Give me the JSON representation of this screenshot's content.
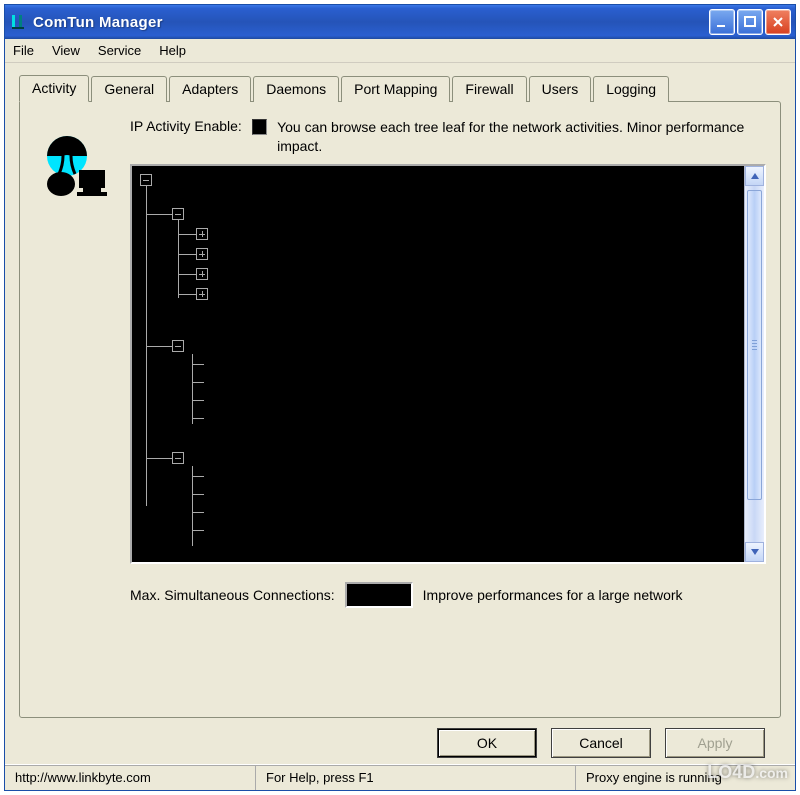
{
  "window": {
    "title": "ComTun Manager"
  },
  "menu": {
    "items": [
      "File",
      "View",
      "Service",
      "Help"
    ]
  },
  "tabs": [
    "Activity",
    "General",
    "Adapters",
    "Daemons",
    "Port Mapping",
    "Firewall",
    "Users",
    "Logging"
  ],
  "active_tab": 0,
  "activity": {
    "enable_label": "IP Activity Enable:",
    "enable_checked": false,
    "enable_desc": "You can browse each tree leaf for the network activities. Minor performance impact.",
    "max_label": "Max. Simultaneous Connections:",
    "max_value": "",
    "max_desc": "Improve performances for a large network"
  },
  "buttons": {
    "ok": "OK",
    "cancel": "Cancel",
    "apply": "Apply"
  },
  "status": {
    "url": "http://www.linkbyte.com",
    "help": "For Help, press F1",
    "engine": "Proxy engine is running"
  },
  "watermark": "LO4D"
}
